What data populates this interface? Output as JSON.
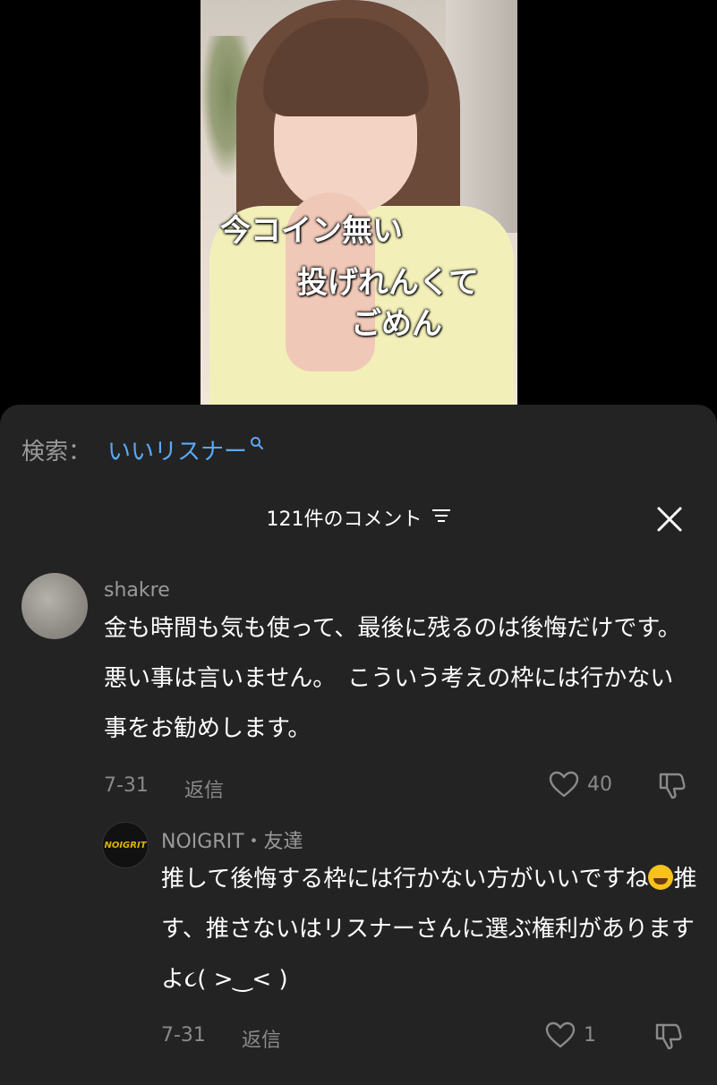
{
  "video": {
    "caption_line1": "今コイン無い",
    "caption_line2": "投げれんくて",
    "caption_line3": "ごめん"
  },
  "search": {
    "label": "検索：",
    "term": "いいリスナー",
    "icon": "search-icon"
  },
  "comments_header": {
    "title": "121件のコメント",
    "sort_icon": "sort-icon",
    "close_icon": "close-icon"
  },
  "comments": [
    {
      "username": "shakre",
      "text": "金も時間も気も使って、最後に残るのは後悔だけです。　悪い事は言いません。　こういう考えの枠には行かない事をお勧めします。",
      "date": "7-31",
      "reply_label": "返信",
      "likes": "40"
    },
    {
      "username": "NOIGRIT・友達",
      "avatar_text": "NOIGRIT",
      "text_part1": "推して後悔する枠には行かない方がいいですね",
      "text_part2": "推す、推さないはリスナーさんに選ぶ権利がありますよ૮( >‿< )",
      "date": "7-31",
      "reply_label": "返信",
      "likes": "1"
    }
  ],
  "colors": {
    "panel_bg": "#232323",
    "link_blue": "#5aa9f5",
    "muted": "#8a8a8a"
  }
}
